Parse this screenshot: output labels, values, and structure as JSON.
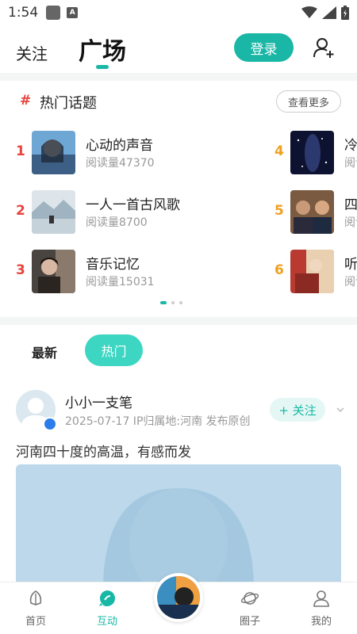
{
  "status_bar": {
    "time": "1:54",
    "badge": "A"
  },
  "header": {
    "tab_follow": "关注",
    "tab_square": "广场",
    "login": "登录",
    "accent": "#1ab6a6"
  },
  "topics": {
    "hash": "#",
    "title": "热门话题",
    "more": "查看更多",
    "items": [
      {
        "rank": "1",
        "name": "心动的声音",
        "reads": "阅读量47370"
      },
      {
        "rank": "2",
        "name": "一人一首古风歌",
        "reads": "阅读量8700"
      },
      {
        "rank": "3",
        "name": "音乐记忆",
        "reads": "阅读量15031"
      },
      {
        "rank": "4",
        "name": "冷",
        "reads": "阅读"
      },
      {
        "rank": "5",
        "name": "四",
        "reads": "阅读"
      },
      {
        "rank": "6",
        "name": "听",
        "reads": "阅读"
      }
    ]
  },
  "feed_tabs": {
    "latest": "最新",
    "hot": "热门"
  },
  "post": {
    "author": "小小一支笔",
    "meta": "2025-07-17 IP归属地:河南 发布原创",
    "follow": "+ 关注",
    "text": "河南四十度的高温，有感而发"
  },
  "bottom_nav": {
    "home": "首页",
    "interact": "互动",
    "circle": "圈子",
    "mine": "我的"
  }
}
